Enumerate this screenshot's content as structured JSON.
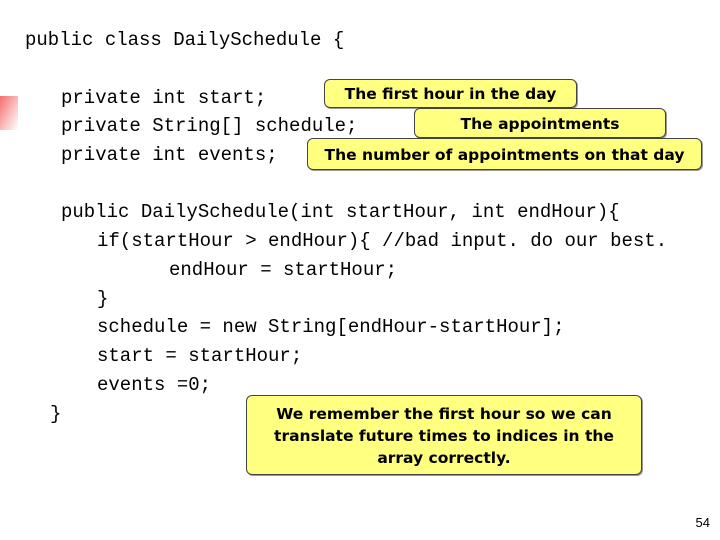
{
  "slide": {
    "page_number": "54",
    "code": {
      "class_decl": "public class DailySchedule {",
      "field_start": "private int start;",
      "field_schedule": "private String[] schedule;",
      "field_events": "private int events;",
      "ctor_decl": "public DailySchedule(int startHour, int endHour){",
      "if_line": "if(startHour > endHour){ //bad input. do our best.",
      "assign_end": "endHour = startHour;",
      "close_if": "}",
      "schedule_new": "schedule = new String[endHour-startHour];",
      "start_assign": "start = startHour;",
      "events_assign": "events =0;",
      "close_ctor": "}"
    },
    "callouts": {
      "start": "The first hour in the day",
      "schedule": "The appointments",
      "events": "The number of appointments on that day",
      "explanation_lines": [
        "We remember the first hour so we can",
        "translate future times to indices in the",
        "array correctly."
      ]
    },
    "colors": {
      "callout_fill": "#ffff80",
      "accent": "#f36d6d"
    }
  }
}
